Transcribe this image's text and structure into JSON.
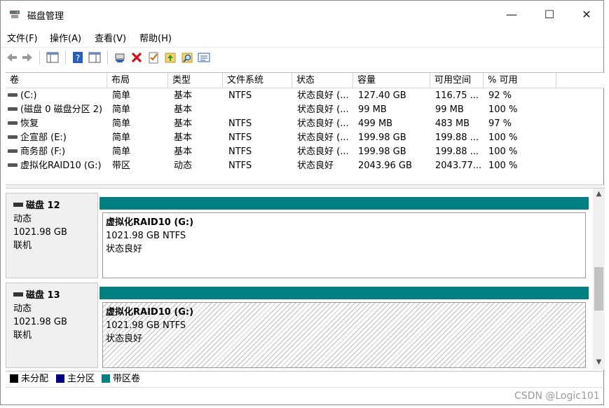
{
  "window": {
    "title": "磁盘管理",
    "controls": {
      "minimize": "—",
      "maximize": "☐",
      "close": "✕"
    }
  },
  "menu": [
    "文件(F)",
    "操作(A)",
    "查看(V)",
    "帮助(H)"
  ],
  "toolbar_icons": [
    "back-icon",
    "forward-icon",
    "console-tree-icon",
    "help-icon",
    "properties-pane-icon",
    "connect-icon",
    "delete-icon",
    "checklist-icon",
    "up-folder-icon",
    "search-folder-icon",
    "details-icon"
  ],
  "volume_table": {
    "columns": [
      "卷",
      "布局",
      "类型",
      "文件系统",
      "状态",
      "容量",
      "可用空间",
      "% 可用"
    ],
    "rows": [
      [
        "(C:)",
        "简单",
        "基本",
        "NTFS",
        "状态良好 (...",
        "127.40 GB",
        "116.75 ...",
        "92 %"
      ],
      [
        "(磁盘 0 磁盘分区 2)",
        "简单",
        "基本",
        "",
        "状态良好 (...",
        "99 MB",
        "99 MB",
        "100 %"
      ],
      [
        "恢复",
        "简单",
        "基本",
        "NTFS",
        "状态良好 (...",
        "499 MB",
        "483 MB",
        "97 %"
      ],
      [
        "企宣部 (E:)",
        "简单",
        "基本",
        "NTFS",
        "状态良好 (...",
        "199.98 GB",
        "199.88 ...",
        "100 %"
      ],
      [
        "商务部 (F:)",
        "简单",
        "基本",
        "NTFS",
        "状态良好 (...",
        "199.98 GB",
        "199.88 ...",
        "100 %"
      ],
      [
        "虚拟化RAID10 (G:)",
        "带区",
        "动态",
        "NTFS",
        "状态良好",
        "2043.96 GB",
        "2043.77...",
        "100 %"
      ]
    ]
  },
  "disks": [
    {
      "name": "磁盘 12",
      "type": "动态",
      "size": "1021.98 GB",
      "status": "联机",
      "partition": {
        "name": "虚拟化RAID10 (G:)",
        "detail": "1021.98 GB NTFS",
        "status": "状态良好",
        "selected": false
      }
    },
    {
      "name": "磁盘 13",
      "type": "动态",
      "size": "1021.98 GB",
      "status": "联机",
      "partition": {
        "name": "虚拟化RAID10 (G:)",
        "detail": "1021.98 GB NTFS",
        "status": "状态良好",
        "selected": true
      }
    }
  ],
  "legend": [
    {
      "label": "未分配",
      "color": "#000000"
    },
    {
      "label": "主分区",
      "color": "#000080"
    },
    {
      "label": "带区卷",
      "color": "#008080"
    }
  ],
  "watermark": "CSDN @Logic101"
}
